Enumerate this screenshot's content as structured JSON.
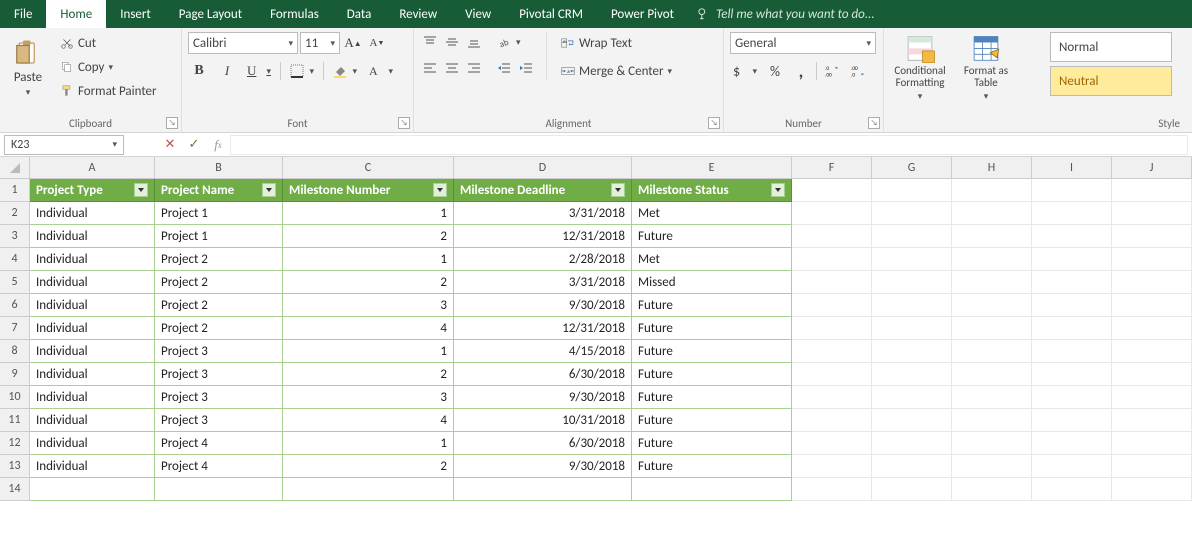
{
  "tabs": [
    "File",
    "Home",
    "Insert",
    "Page Layout",
    "Formulas",
    "Data",
    "Review",
    "View",
    "Pivotal CRM",
    "Power Pivot"
  ],
  "active_tab_index": 1,
  "tellme": "Tell me what you want to do...",
  "ribbon": {
    "clipboard": {
      "title": "Clipboard",
      "paste": "Paste",
      "cut": "Cut",
      "copy": "Copy",
      "format_painter": "Format Painter"
    },
    "font": {
      "title": "Font",
      "name": "Calibri",
      "size": "11",
      "bold": "B",
      "italic": "I",
      "underline": "U"
    },
    "alignment": {
      "title": "Alignment",
      "wrap": "Wrap Text",
      "merge": "Merge & Center"
    },
    "number": {
      "title": "Number",
      "format": "General"
    },
    "cond_fmt": {
      "label": "Conditional Formatting"
    },
    "fmt_table": {
      "label": "Format as Table"
    },
    "styles": {
      "title": "Style",
      "normal": "Normal",
      "neutral": "Neutral"
    }
  },
  "namebox": "K23",
  "columns": [
    "A",
    "B",
    "C",
    "D",
    "E",
    "F",
    "G",
    "H",
    "I",
    "J"
  ],
  "col_classes": [
    "cA",
    "cB",
    "cC",
    "cD",
    "cE",
    "cF",
    "cG",
    "cH",
    "cI",
    "cJ"
  ],
  "table_headers": [
    "Project Type",
    "Project Name",
    "Milestone Number",
    "Milestone Deadline",
    "Milestone Status"
  ],
  "table_rows": [
    [
      "Individual",
      "Project 1",
      "1",
      "3/31/2018",
      "Met"
    ],
    [
      "Individual",
      "Project 1",
      "2",
      "12/31/2018",
      "Future"
    ],
    [
      "Individual",
      "Project 2",
      "1",
      "2/28/2018",
      "Met"
    ],
    [
      "Individual",
      "Project 2",
      "2",
      "3/31/2018",
      "Missed"
    ],
    [
      "Individual",
      "Project 2",
      "3",
      "9/30/2018",
      "Future"
    ],
    [
      "Individual",
      "Project 2",
      "4",
      "12/31/2018",
      "Future"
    ],
    [
      "Individual",
      "Project 3",
      "1",
      "4/15/2018",
      "Future"
    ],
    [
      "Individual",
      "Project 3",
      "2",
      "6/30/2018",
      "Future"
    ],
    [
      "Individual",
      "Project 3",
      "3",
      "9/30/2018",
      "Future"
    ],
    [
      "Individual",
      "Project 3",
      "4",
      "10/31/2018",
      "Future"
    ],
    [
      "Individual",
      "Project 4",
      "1",
      "6/30/2018",
      "Future"
    ],
    [
      "Individual",
      "Project 4",
      "2",
      "9/30/2018",
      "Future"
    ]
  ]
}
